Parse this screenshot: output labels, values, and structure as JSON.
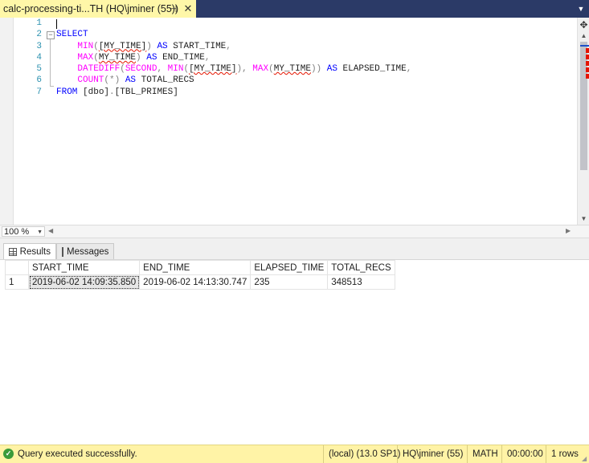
{
  "tab": {
    "title": "calc-processing-ti...TH (HQ\\jminer (55))",
    "pin_icon": "pin-icon",
    "close_icon": "close-icon"
  },
  "editor": {
    "line_numbers": [
      "1",
      "2",
      "3",
      "4",
      "5",
      "6",
      "7"
    ],
    "lines": [
      [],
      [
        {
          "t": "SELECT",
          "c": "kw"
        }
      ],
      [
        {
          "t": "    "
        },
        {
          "t": "MIN",
          "c": "fn"
        },
        {
          "t": "(",
          "c": "gr"
        },
        {
          "t": "[MY_TIME]",
          "c": "tx sq"
        },
        {
          "t": ")",
          "c": "gr"
        },
        {
          "t": " AS ",
          "c": "kw"
        },
        {
          "t": "START_TIME",
          "c": "tx"
        },
        {
          "t": ",",
          "c": "gr"
        }
      ],
      [
        {
          "t": "    "
        },
        {
          "t": "MAX",
          "c": "fn"
        },
        {
          "t": "(",
          "c": "gr"
        },
        {
          "t": "MY_TIME",
          "c": "tx sq"
        },
        {
          "t": ")",
          "c": "gr"
        },
        {
          "t": " AS ",
          "c": "kw"
        },
        {
          "t": "END_TIME",
          "c": "tx"
        },
        {
          "t": ",",
          "c": "gr"
        }
      ],
      [
        {
          "t": "    "
        },
        {
          "t": "DATEDIFF",
          "c": "fn"
        },
        {
          "t": "(",
          "c": "gr"
        },
        {
          "t": "SECOND",
          "c": "fn"
        },
        {
          "t": ", ",
          "c": "gr"
        },
        {
          "t": "MIN",
          "c": "fn"
        },
        {
          "t": "(",
          "c": "gr"
        },
        {
          "t": "[MY_TIME]",
          "c": "tx sq"
        },
        {
          "t": "), ",
          "c": "gr"
        },
        {
          "t": "MAX",
          "c": "fn"
        },
        {
          "t": "(",
          "c": "gr"
        },
        {
          "t": "MY_TIME",
          "c": "tx sq"
        },
        {
          "t": "))",
          "c": "gr"
        },
        {
          "t": " AS ",
          "c": "kw"
        },
        {
          "t": "ELAPSED_TIME",
          "c": "tx"
        },
        {
          "t": ",",
          "c": "gr"
        }
      ],
      [
        {
          "t": "    "
        },
        {
          "t": "COUNT",
          "c": "fn"
        },
        {
          "t": "(*)",
          "c": "gr"
        },
        {
          "t": " AS ",
          "c": "kw"
        },
        {
          "t": "TOTAL_RECS",
          "c": "tx"
        }
      ],
      [
        {
          "t": "FROM ",
          "c": "kw"
        },
        {
          "t": "[dbo]",
          "c": "tx"
        },
        {
          "t": ".",
          "c": "gr"
        },
        {
          "t": "[TBL_PRIMES]",
          "c": "tx"
        }
      ]
    ]
  },
  "zoom": {
    "value": "100 %"
  },
  "result_tabs": {
    "results": "Results",
    "messages": "Messages"
  },
  "results": {
    "columns": [
      "START_TIME",
      "END_TIME",
      "ELAPSED_TIME",
      "TOTAL_RECS"
    ],
    "rows": [
      {
        "num": "1",
        "cells": [
          "2019-06-02 14:09:35.850",
          "2019-06-02 14:13:30.747",
          "235",
          "348513"
        ]
      }
    ]
  },
  "status": {
    "message": "Query executed successfully.",
    "server": "(local) (13.0 SP1)",
    "user": "HQ\\jminer (55)",
    "database": "MATH",
    "elapsed": "00:00:00",
    "rows": "1 rows"
  },
  "colors": {
    "tab_bar": "#2b3a67",
    "active_tab": "#fff7a8",
    "status_bar": "#fff3a6",
    "keyword": "#0000ff",
    "function": "#ff00ff",
    "line_number": "#2b91af"
  }
}
